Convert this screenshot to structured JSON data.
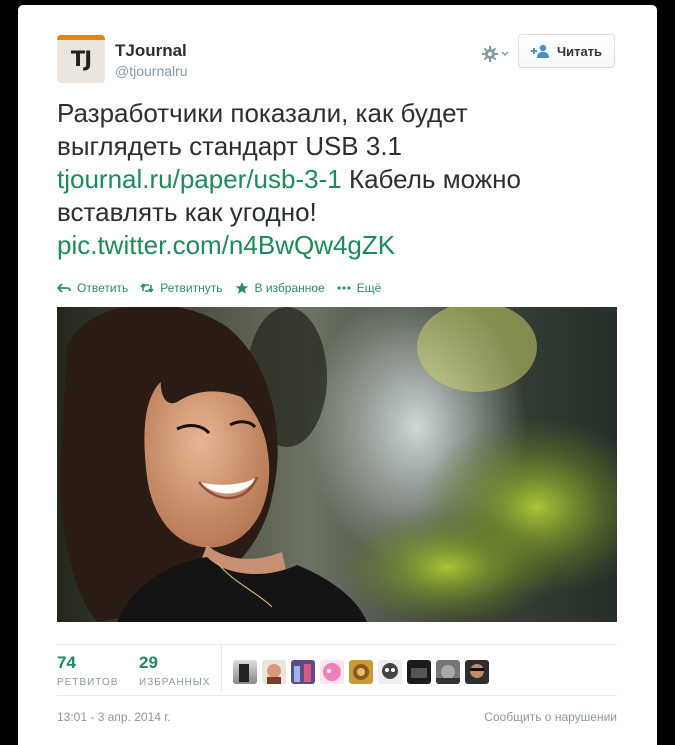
{
  "account": {
    "avatar_text": "TJ",
    "name": "TJournal",
    "handle": "@tjournalru"
  },
  "header": {
    "follow_label": "Читать"
  },
  "tweet": {
    "text_1": "Разработчики показали, как будет выглядеть стандарт USB 3.1",
    "link_1": "tjournal.ru/paper/usb-3-1",
    "text_2": "Кабель можно вставлять как угодно!",
    "link_2": "pic.twitter.com/n4BwQw4gZK"
  },
  "actions": {
    "reply": "Ответить",
    "retweet": "Ретвитнуть",
    "favorite": "В избранное",
    "more": "Ещё"
  },
  "stats": {
    "retweets_count": "74",
    "retweets_label": "РЕТВИТОВ",
    "favorites_count": "29",
    "favorites_label": "ИЗБРАННЫХ"
  },
  "footer": {
    "timestamp": "13:01 - 3 апр. 2014 г.",
    "report_label": "Сообщить о нарушении"
  },
  "colors": {
    "link": "#1c8a5a",
    "muted": "#8899a6",
    "text": "#292f33"
  }
}
